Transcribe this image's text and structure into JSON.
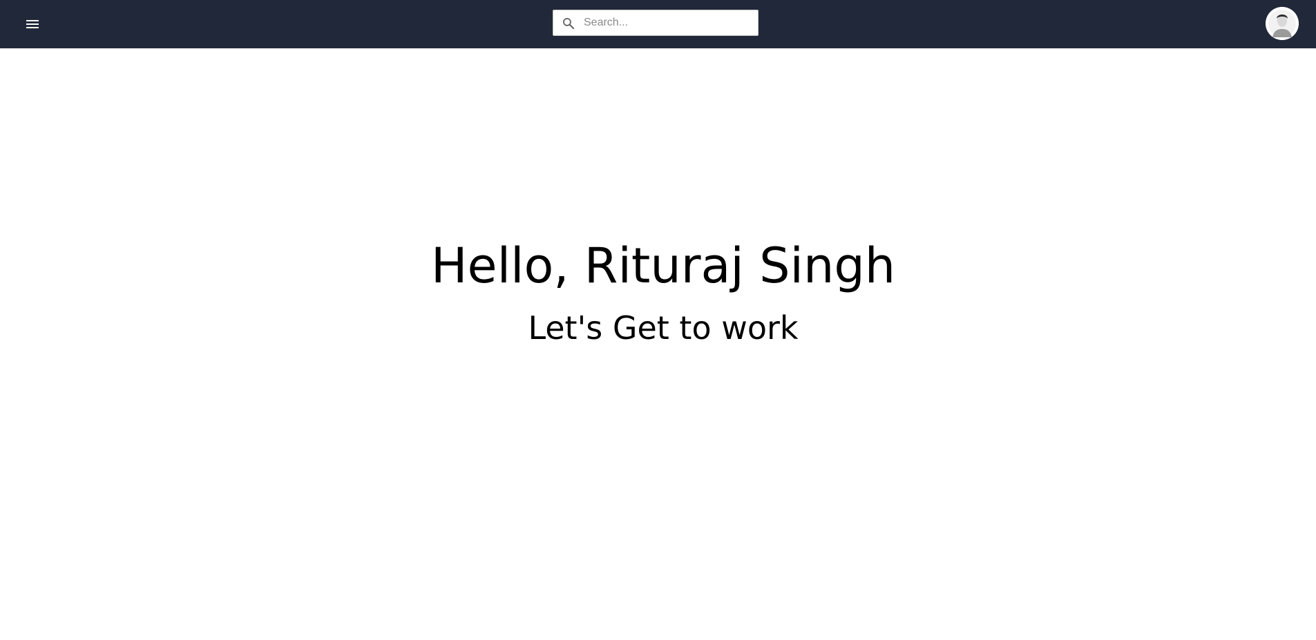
{
  "header": {
    "menu_icon": "hamburger-menu-icon",
    "search": {
      "placeholder": "Search...",
      "value": "",
      "icon": "search-icon"
    },
    "avatar_icon": "user-avatar-icon"
  },
  "main": {
    "greeting": "Hello, Rituraj Singh",
    "subtitle": "Let's Get to work"
  },
  "colors": {
    "topbar_bg": "#212839",
    "page_bg": "#ffffff",
    "text": "#000000"
  }
}
